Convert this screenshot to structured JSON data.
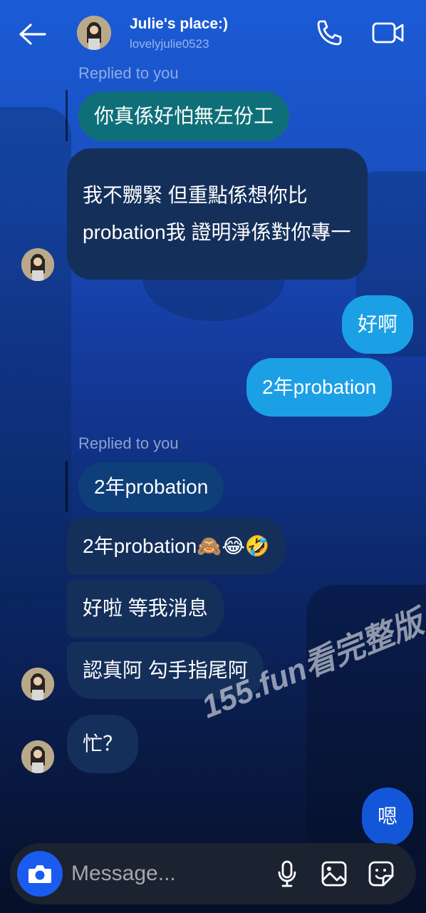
{
  "header": {
    "title": "Julie's place:)",
    "username": "lovelyjulie0523"
  },
  "messages": {
    "reply_label_1": "Replied to you",
    "quoted_1": "你真係好怕無左份工",
    "in_1": "我不嬲緊 但重點係想你比probation我 證明淨係對你專一",
    "out_1": "好啊",
    "out_2": "2年probation",
    "reply_label_2": "Replied to you",
    "quoted_2": "2年probation",
    "in_2": "2年probation🙈😂🤣",
    "in_3": "好啦 等我消息",
    "in_4": "認真阿 勾手指尾阿",
    "in_5": "忙？",
    "out_3": "嗯"
  },
  "watermark": "155.fun看完整版",
  "composer": {
    "placeholder": "Message..."
  },
  "icons": {
    "back": "arrow-left-icon",
    "call": "phone-icon",
    "video": "video-camera-icon",
    "camera": "camera-icon",
    "mic": "microphone-icon",
    "gallery": "image-icon",
    "sticker": "sticker-icon"
  },
  "colors": {
    "incoming_bubble": "#142f5a",
    "outgoing_bubble": "#1ba0e6",
    "camera_button": "#1a5cf0"
  }
}
